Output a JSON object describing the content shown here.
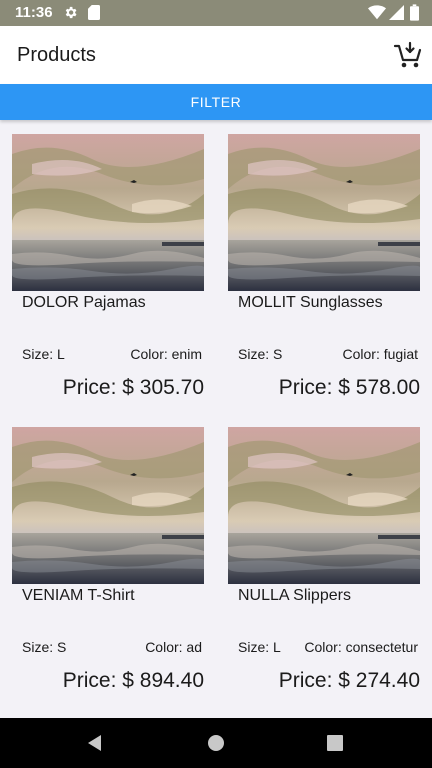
{
  "status_bar": {
    "time": "11:36",
    "icons": [
      "gear-icon",
      "sd-card-icon",
      "wifi-icon",
      "signal-icon",
      "battery-icon"
    ]
  },
  "app_bar": {
    "title": "Products",
    "cart_icon": "cart-add-icon"
  },
  "filter": {
    "label": "FILTER"
  },
  "products": [
    {
      "name": "DOLOR Pajamas",
      "size": "Size: L",
      "color": "Color: enim",
      "price": "Price: $ 305.70"
    },
    {
      "name": "MOLLIT Sunglasses",
      "size": "Size: S",
      "color": "Color: fugiat",
      "price": "Price: $ 578.00"
    },
    {
      "name": "VENIAM T-Shirt",
      "size": "Size: S",
      "color": "Color: ad",
      "price": "Price: $ 894.40"
    },
    {
      "name": "NULLA Slippers",
      "size": "Size: L",
      "color": "Color: consectetur",
      "price": "Price: $ 274.40"
    }
  ],
  "nav_bar": {
    "icons": [
      "back-icon",
      "home-icon",
      "recents-icon"
    ]
  },
  "colors": {
    "status_bar": "#8b8b78",
    "accent": "#2d96f4",
    "background": "#f3f2f7"
  }
}
